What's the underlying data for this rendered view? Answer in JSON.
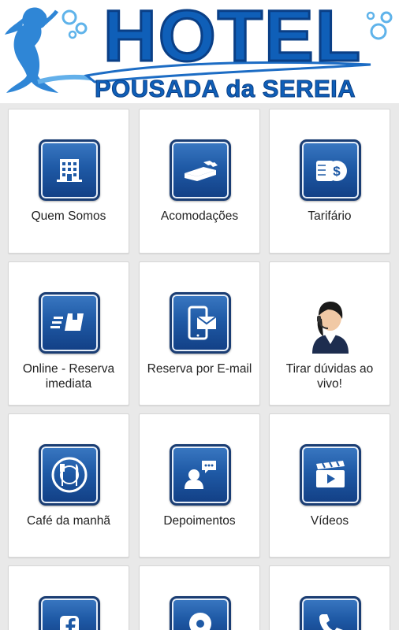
{
  "header": {
    "title": "HOTEL",
    "subtitle": "POUSADA da SEREIA",
    "colors": {
      "brand": "#0f5fb8",
      "brand_dark": "#0a3f86"
    }
  },
  "menu": {
    "items": [
      {
        "label": "Quem Somos",
        "icon": "building-icon"
      },
      {
        "label": "Acomodações",
        "icon": "bed-icon"
      },
      {
        "label": "Tarifário",
        "icon": "money-icon"
      },
      {
        "label": "Online - Reserva imediata",
        "icon": "fast-delivery-icon"
      },
      {
        "label": "Reserva por E-mail",
        "icon": "phone-mail-icon"
      },
      {
        "label": "Tirar dúvidas ao vivo!",
        "icon": "support-agent-icon"
      },
      {
        "label": "Café da manhã",
        "icon": "plate-cutlery-icon"
      },
      {
        "label": "Depoimentos",
        "icon": "testimonial-icon"
      },
      {
        "label": "Vídeos",
        "icon": "video-icon"
      },
      {
        "label": "",
        "icon": "facebook-icon"
      },
      {
        "label": "",
        "icon": "location-pin-icon"
      },
      {
        "label": "",
        "icon": "phone-icon"
      }
    ]
  }
}
